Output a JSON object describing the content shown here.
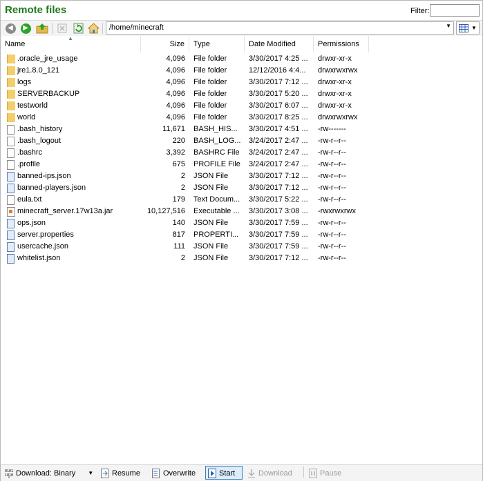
{
  "title": "Remote files",
  "filter": {
    "label": "Filter:",
    "value": ""
  },
  "path": "/home/minecraft",
  "icons": {
    "back": "arrow-left-icon",
    "forward": "arrow-right-icon",
    "up": "parent-folder-icon",
    "stop": "stop-icon",
    "refresh": "refresh-icon",
    "home": "home-icon",
    "view": "grid-view-icon"
  },
  "columns": [
    {
      "label": "Name"
    },
    {
      "label": "Size"
    },
    {
      "label": "Type"
    },
    {
      "label": "Date Modified"
    },
    {
      "label": "Permissions"
    }
  ],
  "files": [
    {
      "name": ".oracle_jre_usage",
      "size": "4,096",
      "type": "File folder",
      "date": "3/30/2017 4:25 ...",
      "perm": "drwxr-xr-x",
      "icon": "folder"
    },
    {
      "name": "jre1.8.0_121",
      "size": "4,096",
      "type": "File folder",
      "date": "12/12/2016 4:4...",
      "perm": "drwxrwxrwx",
      "icon": "folder"
    },
    {
      "name": "logs",
      "size": "4,096",
      "type": "File folder",
      "date": "3/30/2017 7:12 ...",
      "perm": "drwxr-xr-x",
      "icon": "folder"
    },
    {
      "name": "SERVERBACKUP",
      "size": "4,096",
      "type": "File folder",
      "date": "3/30/2017 5:20 ...",
      "perm": "drwxr-xr-x",
      "icon": "folder"
    },
    {
      "name": "testworld",
      "size": "4,096",
      "type": "File folder",
      "date": "3/30/2017 6:07 ...",
      "perm": "drwxr-xr-x",
      "icon": "folder"
    },
    {
      "name": "world",
      "size": "4,096",
      "type": "File folder",
      "date": "3/30/2017 8:25 ...",
      "perm": "drwxrwxrwx",
      "icon": "folder"
    },
    {
      "name": ".bash_history",
      "size": "11,671",
      "type": "BASH_HIS...",
      "date": "3/30/2017 4:51 ...",
      "perm": "-rw-------",
      "icon": "file"
    },
    {
      "name": ".bash_logout",
      "size": "220",
      "type": "BASH_LOG...",
      "date": "3/24/2017 2:47 ...",
      "perm": "-rw-r--r--",
      "icon": "file"
    },
    {
      "name": ".bashrc",
      "size": "3,392",
      "type": "BASHRC File",
      "date": "3/24/2017 2:47 ...",
      "perm": "-rw-r--r--",
      "icon": "file"
    },
    {
      "name": ".profile",
      "size": "675",
      "type": "PROFILE File",
      "date": "3/24/2017 2:47 ...",
      "perm": "-rw-r--r--",
      "icon": "file"
    },
    {
      "name": "banned-ips.json",
      "size": "2",
      "type": "JSON File",
      "date": "3/30/2017 7:12 ...",
      "perm": "-rw-r--r--",
      "icon": "json"
    },
    {
      "name": "banned-players.json",
      "size": "2",
      "type": "JSON File",
      "date": "3/30/2017 7:12 ...",
      "perm": "-rw-r--r--",
      "icon": "json"
    },
    {
      "name": "eula.txt",
      "size": "179",
      "type": "Text Docum...",
      "date": "3/30/2017 5:22 ...",
      "perm": "-rw-r--r--",
      "icon": "file"
    },
    {
      "name": "minecraft_server.17w13a.jar",
      "size": "10,127,516",
      "type": "Executable ...",
      "date": "3/30/2017 3:08 ...",
      "perm": "-rwxrwxrwx",
      "icon": "jar"
    },
    {
      "name": "ops.json",
      "size": "140",
      "type": "JSON File",
      "date": "3/30/2017 7:59 ...",
      "perm": "-rw-r--r--",
      "icon": "json"
    },
    {
      "name": "server.properties",
      "size": "817",
      "type": "PROPERTI...",
      "date": "3/30/2017 7:59 ...",
      "perm": "-rw-r--r--",
      "icon": "json"
    },
    {
      "name": "usercache.json",
      "size": "111",
      "type": "JSON File",
      "date": "3/30/2017 7:59 ...",
      "perm": "-rw-r--r--",
      "icon": "json"
    },
    {
      "name": "whitelist.json",
      "size": "2",
      "type": "JSON File",
      "date": "3/30/2017 7:12 ...",
      "perm": "-rw-r--r--",
      "icon": "json"
    }
  ],
  "statusbar": {
    "download_mode": "Download: Binary",
    "resume": "Resume",
    "overwrite": "Overwrite",
    "start": "Start",
    "download": "Download",
    "pause": "Pause"
  }
}
